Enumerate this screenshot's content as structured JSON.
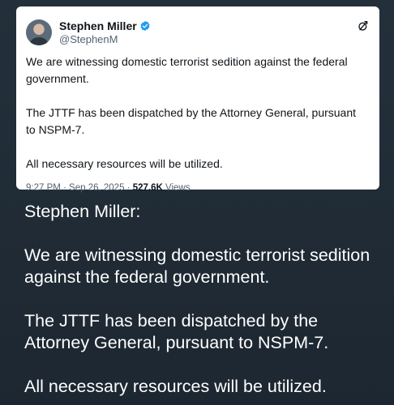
{
  "tweet": {
    "display_name": "Stephen Miller",
    "handle": "@StephenM",
    "paragraphs": [
      "We are witnessing domestic terrorist sedition against the federal government.",
      "The JTTF has been dispatched by the Attorney General, pursuant to NSPM-7.",
      "All necessary resources will be utilized."
    ],
    "timestamp": "9:27 PM · Sep 26, 2025 ·",
    "views_count": "527.6K",
    "views_label": "Views",
    "icons": {
      "verified": "verified-badge-icon",
      "logo": "x-logo-icon"
    },
    "colors": {
      "verified": "#1d9bf0",
      "meta": "#536471"
    }
  },
  "message": {
    "author_line": "Stephen Miller:",
    "paragraphs": [
      "We are witnessing domestic terrorist sedition against the federal government.",
      "The JTTF has been dispatched by the Attorney General, pursuant to NSPM-7.",
      "All necessary resources will be utilized."
    ]
  }
}
